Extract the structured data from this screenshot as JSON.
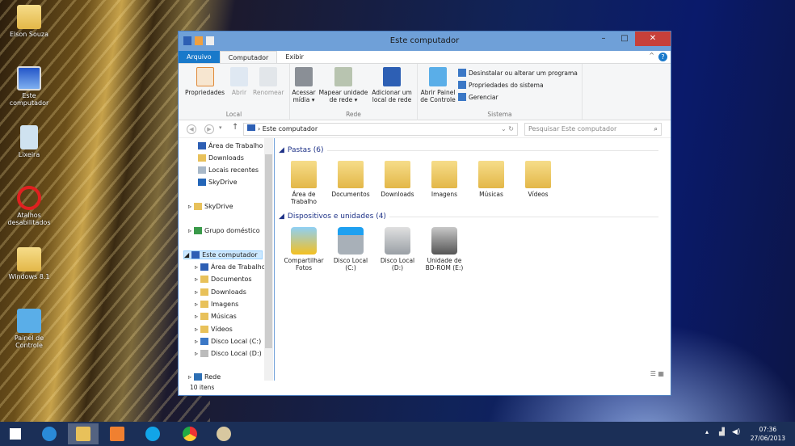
{
  "desktop": {
    "icons": [
      "Elson Souza",
      "Este computador",
      "Lixeira",
      "Atalhos desabilitados",
      "Windows 8.1",
      "Painel de Controle"
    ]
  },
  "window": {
    "title": "Este computador",
    "tabs": [
      "Arquivo",
      "Computador",
      "Exibir"
    ],
    "ribbon": {
      "local": {
        "label": "Local",
        "buttons": [
          "Propriedades",
          "Abrir",
          "Renomear"
        ]
      },
      "rede": {
        "label": "Rede",
        "buttons": [
          "Acessar mídia ▾",
          "Mapear unidade de rede ▾",
          "Adicionar um local de rede"
        ]
      },
      "sistema": {
        "label": "Sistema",
        "button": "Abrir Painel de Controle",
        "links": [
          "Desinstalar ou alterar um programa",
          "Propriedades do sistema",
          "Gerenciar"
        ]
      }
    },
    "address": {
      "path": "Este computador",
      "search_placeholder": "Pesquisar Este computador"
    },
    "nav": {
      "favorites": [
        "Área de Trabalho",
        "Downloads",
        "Locais recentes",
        "SkyDrive"
      ],
      "skydrive": "SkyDrive",
      "homegroup": "Grupo doméstico",
      "computer": "Este computador",
      "computer_children": [
        "Área de Trabalho",
        "Documentos",
        "Downloads",
        "Imagens",
        "Músicas",
        "Vídeos",
        "Disco Local (C:)",
        "Disco Local (D:)"
      ],
      "network": "Rede"
    },
    "folders": {
      "header": "Pastas (6)",
      "items": [
        "Área de Trabalho",
        "Documentos",
        "Downloads",
        "Imagens",
        "Músicas",
        "Vídeos"
      ]
    },
    "devices": {
      "header": "Dispositivos e unidades (4)",
      "items": [
        "Compartilhar Fotos",
        "Disco Local (C:)",
        "Disco Local (D:)",
        "Unidade de BD-ROM (E:)"
      ]
    },
    "status": "10 itens"
  },
  "taskbar": {
    "time": "07:36",
    "date": "27/06/2013"
  },
  "colors": {
    "titlebar": "#6fa0d8",
    "file_tab": "#1979ca",
    "close": "#c7403a",
    "taskbar": "#1b2f57"
  }
}
